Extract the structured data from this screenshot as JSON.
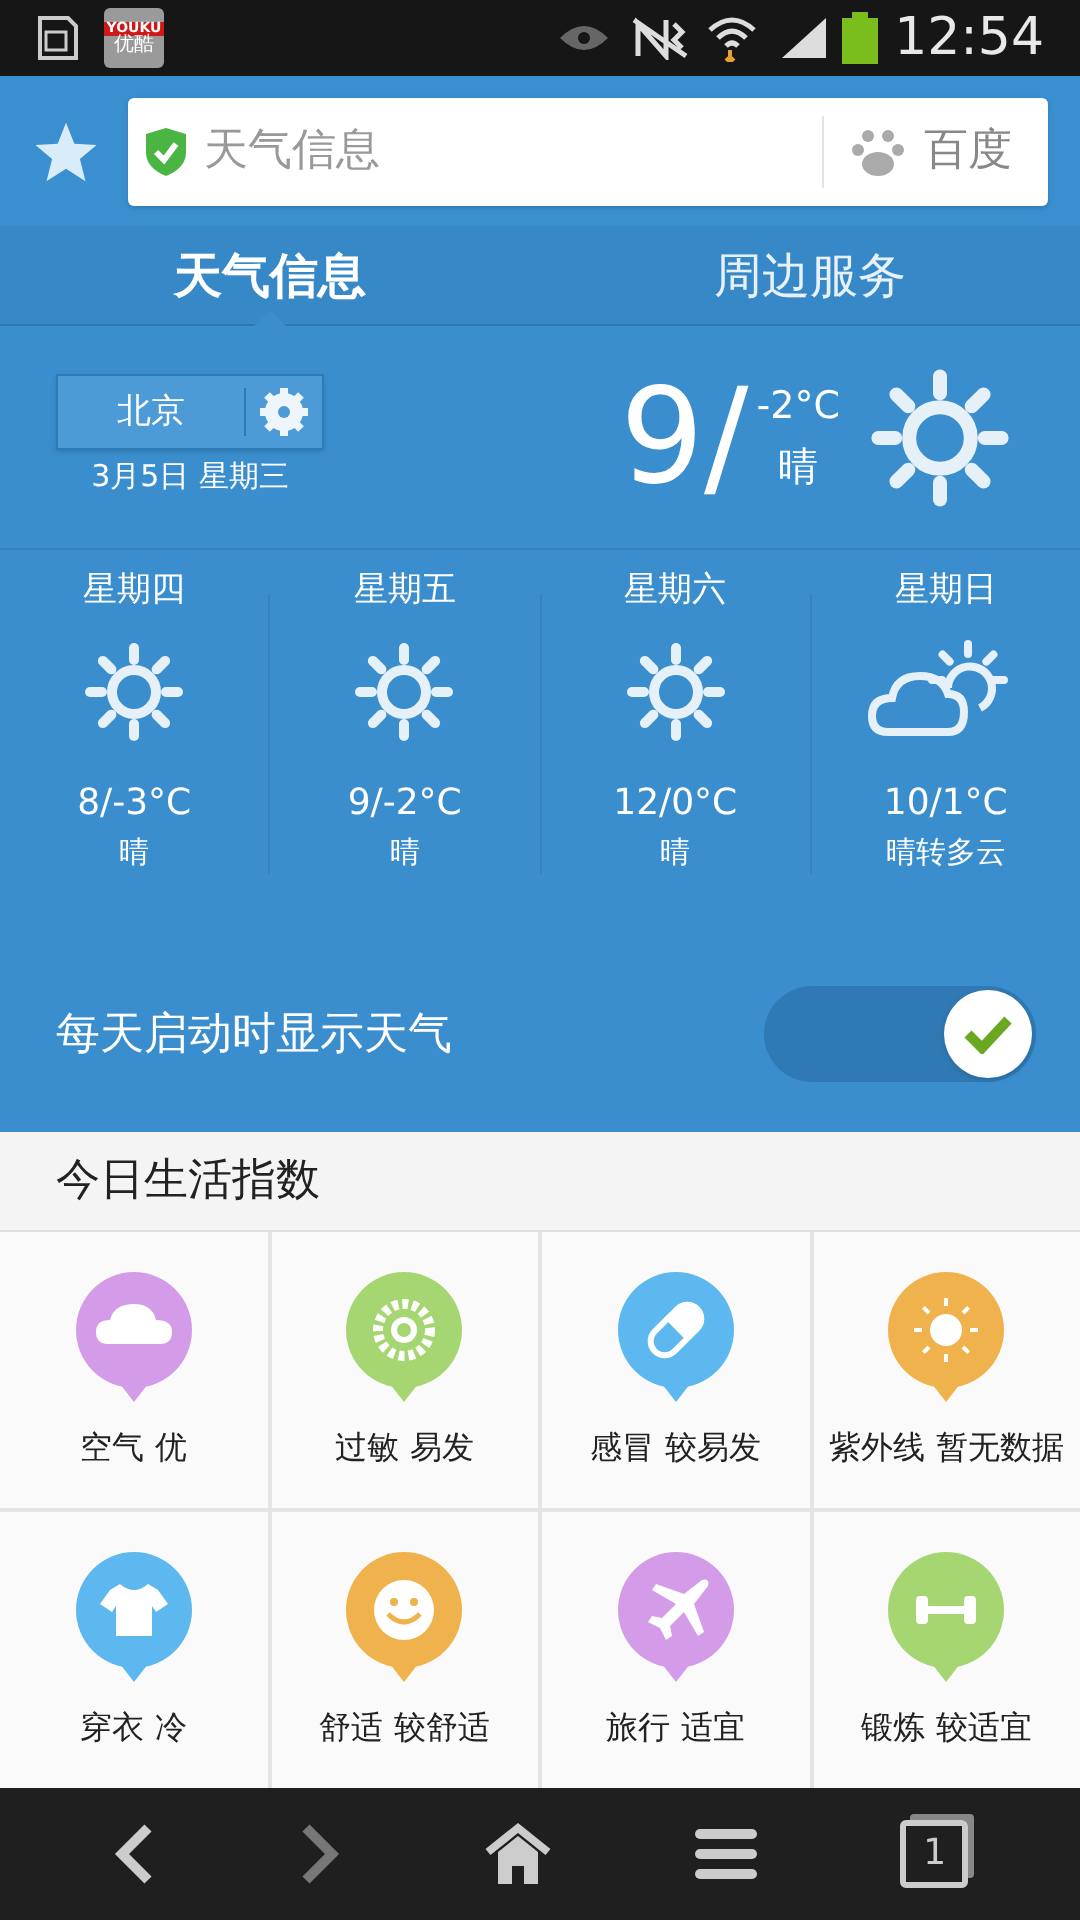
{
  "status_bar": {
    "app_badge": {
      "line1": "YOUKU",
      "line2": "优酷"
    },
    "time": "12:54"
  },
  "address_bar": {
    "value": "天气信息",
    "engine": "百度"
  },
  "tabs": [
    {
      "label": "天气信息",
      "selected": true
    },
    {
      "label": "周边服务",
      "selected": false
    }
  ],
  "current": {
    "city": "北京",
    "date": "3月5日 星期三",
    "high": "9/",
    "low": "-2°C",
    "condition": "晴",
    "kind": "sunny"
  },
  "forecast": [
    {
      "day": "星期四",
      "kind": "sunny",
      "temp": "8/-3°C",
      "condition": "晴"
    },
    {
      "day": "星期五",
      "kind": "sunny",
      "temp": "9/-2°C",
      "condition": "晴"
    },
    {
      "day": "星期六",
      "kind": "sunny",
      "temp": "12/0°C",
      "condition": "晴"
    },
    {
      "day": "星期日",
      "kind": "partly_cloudy",
      "temp": "10/1°C",
      "condition": "晴转多云"
    }
  ],
  "startup_toggle": {
    "label": "每天启动时显示天气",
    "on": true
  },
  "life_index": {
    "title": "今日生活指数",
    "items": [
      {
        "kind": "cloud",
        "color": "#d49ce8",
        "label": "空气 优"
      },
      {
        "kind": "flower",
        "color": "#a6d672",
        "label": "过敏 易发"
      },
      {
        "kind": "pill",
        "color": "#5cb8ee",
        "label": "感冒 较易发"
      },
      {
        "kind": "sun",
        "color": "#f0b24c",
        "label": "紫外线 暂无数据"
      },
      {
        "kind": "shirt",
        "color": "#5cb8ee",
        "label": "穿衣 冷"
      },
      {
        "kind": "smile",
        "color": "#f0b24c",
        "label": "舒适 较舒适"
      },
      {
        "kind": "plane",
        "color": "#d49ce8",
        "label": "旅行 适宜"
      },
      {
        "kind": "dumbbell",
        "color": "#a6d672",
        "label": "锻炼 较适宜"
      }
    ]
  },
  "bottom_nav": {
    "tab_count": "1"
  }
}
